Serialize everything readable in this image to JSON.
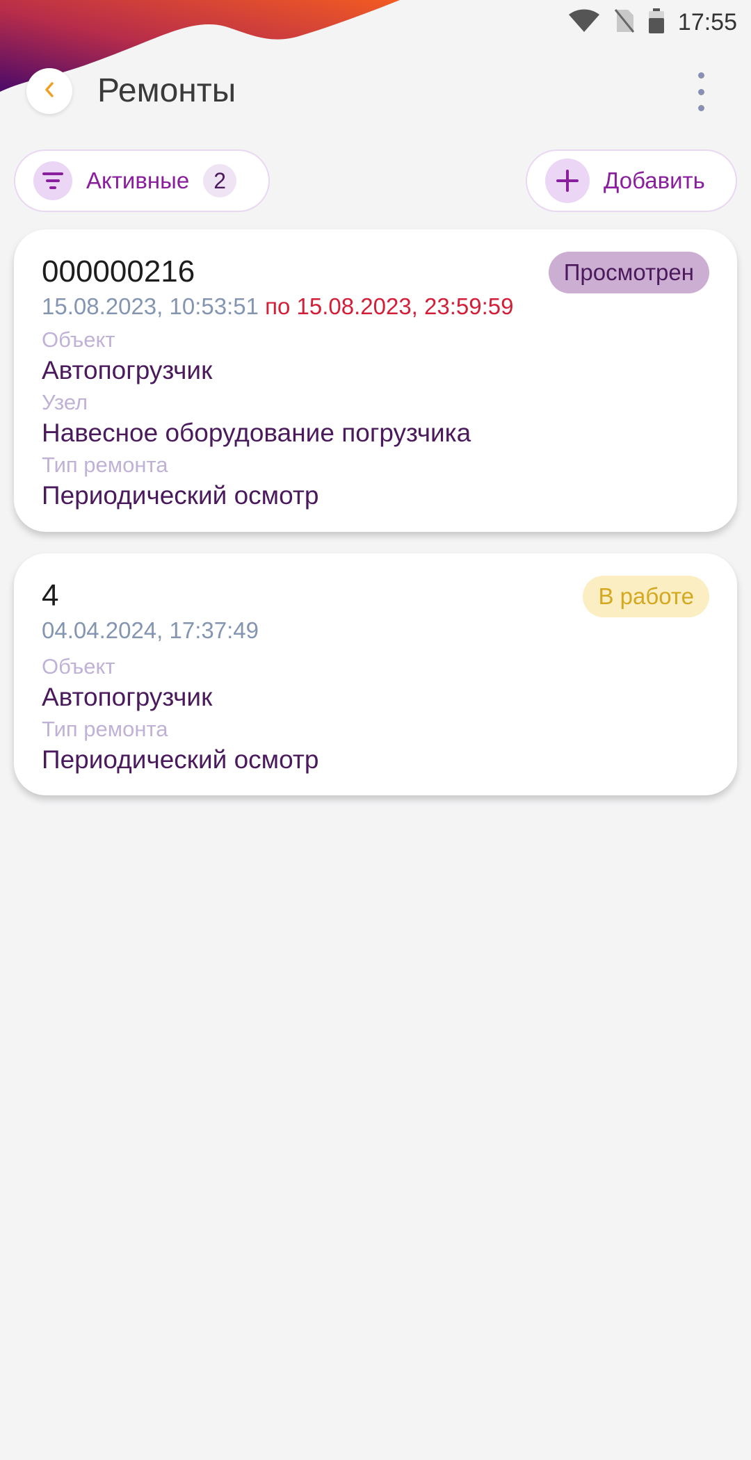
{
  "status_bar": {
    "time": "17:55"
  },
  "header": {
    "title": "Ремонты"
  },
  "filter_chip": {
    "label": "Активные",
    "count": "2"
  },
  "add_chip": {
    "label": "Добавить"
  },
  "colors": {
    "accent": "#8a1f9e",
    "due_date": "#d21f37",
    "status_viewed_bg": "#ccaed3",
    "status_working_bg": "#fbeec3",
    "status_working_text": "#d4a81f"
  },
  "repairs": [
    {
      "number": "000000216",
      "status": "Просмотрен",
      "start": "15.08.2023, 10:53:51",
      "due": "по 15.08.2023, 23:59:59",
      "object_label": "Объект",
      "object": "Автопогрузчик",
      "node_label": "Узел",
      "node": "Навесное оборудование погрузчика",
      "type_label": "Тип ремонта",
      "type": "Периодический осмотр"
    },
    {
      "number": "4",
      "status": "В работе",
      "start": "04.04.2024, 17:37:49",
      "object_label": "Объект",
      "object": "Автопогрузчик",
      "type_label": "Тип ремонта",
      "type": "Периодический осмотр"
    }
  ]
}
